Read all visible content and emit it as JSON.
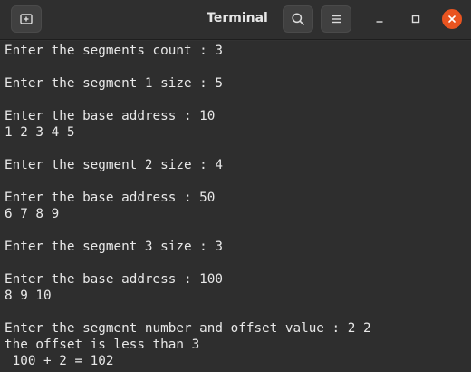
{
  "window": {
    "title": "Terminal"
  },
  "icons": {
    "new_tab": "new-tab-icon",
    "search": "search-icon",
    "menu": "hamburger-menu-icon",
    "minimize": "minimize-icon",
    "maximize": "maximize-icon",
    "close": "close-icon"
  },
  "colors": {
    "close_button": "#e95420",
    "terminal_bg": "#2e2e2e",
    "terminal_text": "#e8e8e8"
  },
  "terminal": {
    "lines": [
      "Enter the segments count : 3",
      "",
      "Enter the segment 1 size : 5",
      "",
      "Enter the base address : 10",
      "1 2 3 4 5",
      "",
      "Enter the segment 2 size : 4",
      "",
      "Enter the base address : 50",
      "6 7 8 9",
      "",
      "Enter the segment 3 size : 3",
      "",
      "Enter the base address : 100",
      "8 9 10",
      "",
      "Enter the segment number and offset value : 2 2",
      "the offset is less than 3",
      " 100 + 2 = 102"
    ]
  }
}
